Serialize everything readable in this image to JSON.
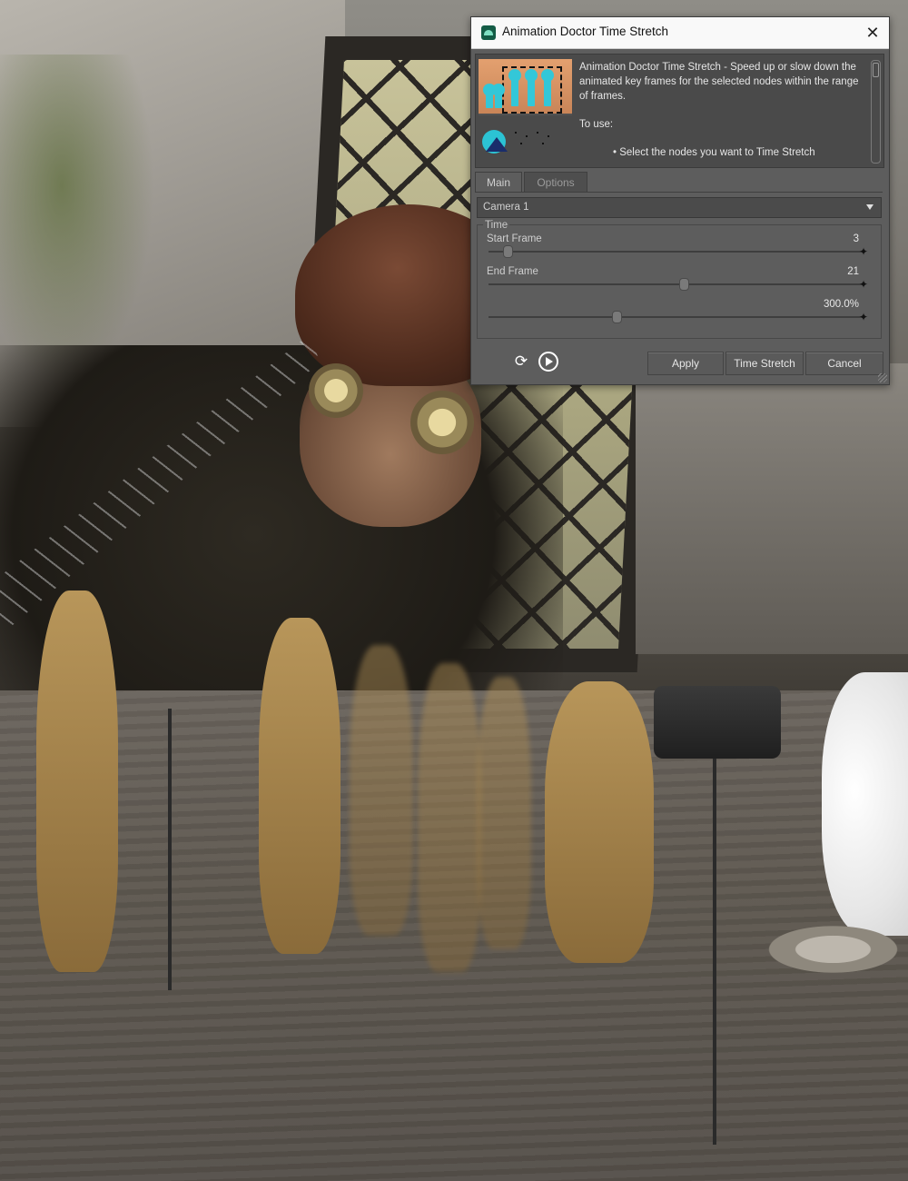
{
  "dialog": {
    "title": "Animation Doctor Time Stretch",
    "close_glyph": "✕",
    "description": {
      "intro": "Animation Doctor Time Stretch - Speed up or slow down the animated key frames for the selected nodes within the range of frames.",
      "to_use": "To use:",
      "bullet": "• Select the nodes you want to Time Stretch"
    },
    "tabs": {
      "main": "Main",
      "options": "Options"
    },
    "camera": "Camera 1",
    "group_label": "Time",
    "start_frame": {
      "label": "Start Frame",
      "value": "3",
      "fraction": 0.04
    },
    "end_frame": {
      "label": "End Frame",
      "value": "21",
      "fraction": 0.51
    },
    "stretch": {
      "value": "300.0%",
      "fraction": 0.33
    },
    "buttons": {
      "apply": "Apply",
      "time_stretch": "Time Stretch",
      "cancel": "Cancel"
    },
    "icons": {
      "loop": "loop-icon",
      "play": "play-icon",
      "app": "animation-doctor-app-icon"
    }
  },
  "colors": {
    "panel": "#5d5d5d",
    "titlebar": "#f9f9f9",
    "accent_cyan": "#33c7d8",
    "thumb_orange": "#d8946a"
  }
}
